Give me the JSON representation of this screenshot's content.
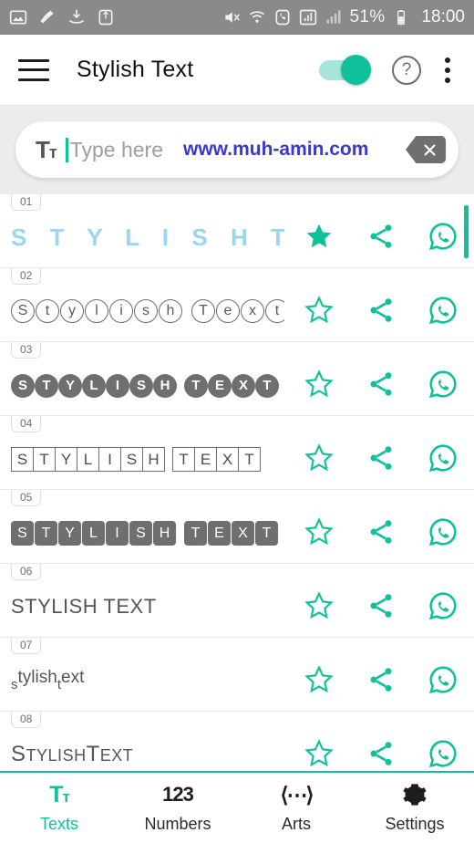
{
  "status_bar": {
    "left_icons": [
      "image-icon",
      "broom-icon",
      "download-icon",
      "recycle-icon"
    ],
    "right_icons": [
      "mute-icon",
      "wifi-icon",
      "phone-icon",
      "signal-icon",
      "signal2-icon"
    ],
    "battery_percent": "51%",
    "time": "18:00"
  },
  "app_bar": {
    "title": "Stylish Text",
    "menu_icon": "hamburger-icon",
    "toggle_state": "on",
    "help_icon": "?",
    "overflow_icon": "more-vertical-icon"
  },
  "search": {
    "font_icon_main": "T",
    "font_icon_small": "т",
    "placeholder": "Type here",
    "value": "",
    "watermark": "www.muh-amin.com",
    "clear_icon": "backspace-clear-icon"
  },
  "list": {
    "action_icons": [
      "star-icon",
      "share-icon",
      "whatsapp-icon"
    ],
    "items": [
      {
        "num": "01",
        "style": "spaced",
        "text": "S T Y L I S H T",
        "ellipsis": "..",
        "favorited": true
      },
      {
        "num": "02",
        "style": "circle-outline",
        "text": "Stylish Text",
        "favorited": false
      },
      {
        "num": "03",
        "style": "circle-filled",
        "text": "STYLISH TEXT",
        "favorited": false
      },
      {
        "num": "04",
        "style": "square-outline",
        "text": "STYLISH TEXT",
        "favorited": false
      },
      {
        "num": "05",
        "style": "square-filled",
        "text": "STYLISH TEXT",
        "favorited": false
      },
      {
        "num": "06",
        "style": "plain-upper",
        "text": "STYLISH TEXT",
        "favorited": false
      },
      {
        "num": "07",
        "style": "superscript",
        "text": "Stylish Text",
        "favorited": false
      },
      {
        "num": "08",
        "style": "small-caps",
        "text": "Stylish Text",
        "favorited": false
      }
    ]
  },
  "bottom_nav": {
    "items": [
      {
        "label": "Texts",
        "icon": "text-format-icon",
        "active": true
      },
      {
        "label": "Numbers",
        "icon": "123-icon",
        "active": false
      },
      {
        "label": "Arts",
        "icon": "arts-icon",
        "active": false
      },
      {
        "label": "Settings",
        "icon": "gear-icon",
        "active": false
      }
    ]
  },
  "colors": {
    "accent": "#0ec19b",
    "statusbar": "#8a8a8a",
    "watermark": "#3b37cf",
    "row01_text": "#9ad6ef"
  }
}
